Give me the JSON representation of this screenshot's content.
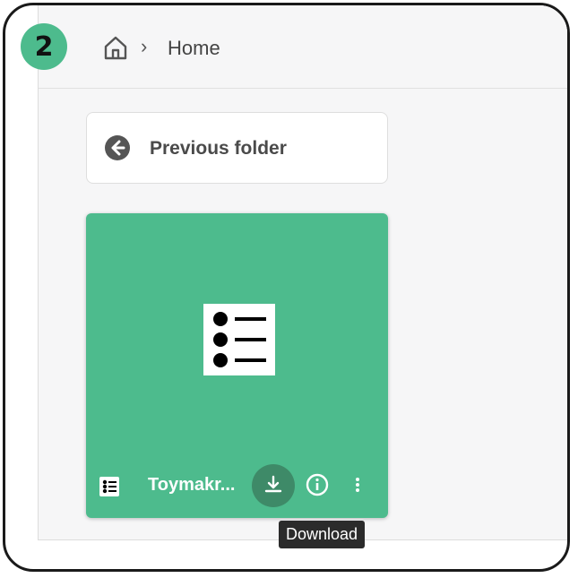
{
  "step_badge": "2",
  "breadcrumb": {
    "home_icon": "home-icon",
    "separator": "›",
    "current": "Home"
  },
  "previous_folder": {
    "icon": "arrow-left-circle-icon",
    "label": "Previous folder"
  },
  "file_card": {
    "name": "Toymakr...",
    "type_icon": "list-icon",
    "thumbnail_icon": "bulleted-list-icon",
    "accent_color": "#4dbb8d",
    "actions": {
      "download_icon": "download-icon",
      "info_icon": "info-icon",
      "more_icon": "more-vertical-icon"
    }
  },
  "tooltip": {
    "text": "Download"
  }
}
